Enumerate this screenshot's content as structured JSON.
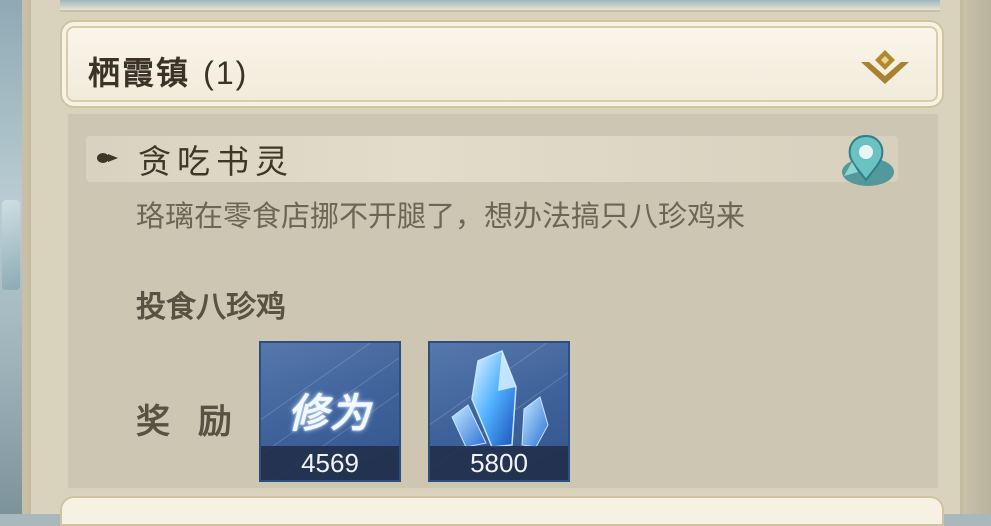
{
  "region": {
    "title": "栖霞镇",
    "count": "(1)"
  },
  "quest": {
    "name": "贪吃书灵",
    "description": "珞璃在零食店挪不开腿了，想办法搞只八珍鸡来",
    "objective": "投食八珍鸡"
  },
  "rewards": {
    "label": "奖 励",
    "items": [
      {
        "name": "修为",
        "quantity": "4569",
        "icon": "cultivation-icon"
      },
      {
        "name": "",
        "quantity": "5800",
        "icon": "blue-crystal-icon"
      }
    ]
  },
  "colors": {
    "accent_gold": "#b08a2e",
    "reward_bg": "#4a6da3",
    "locate_icon": "#4fa3a8"
  }
}
